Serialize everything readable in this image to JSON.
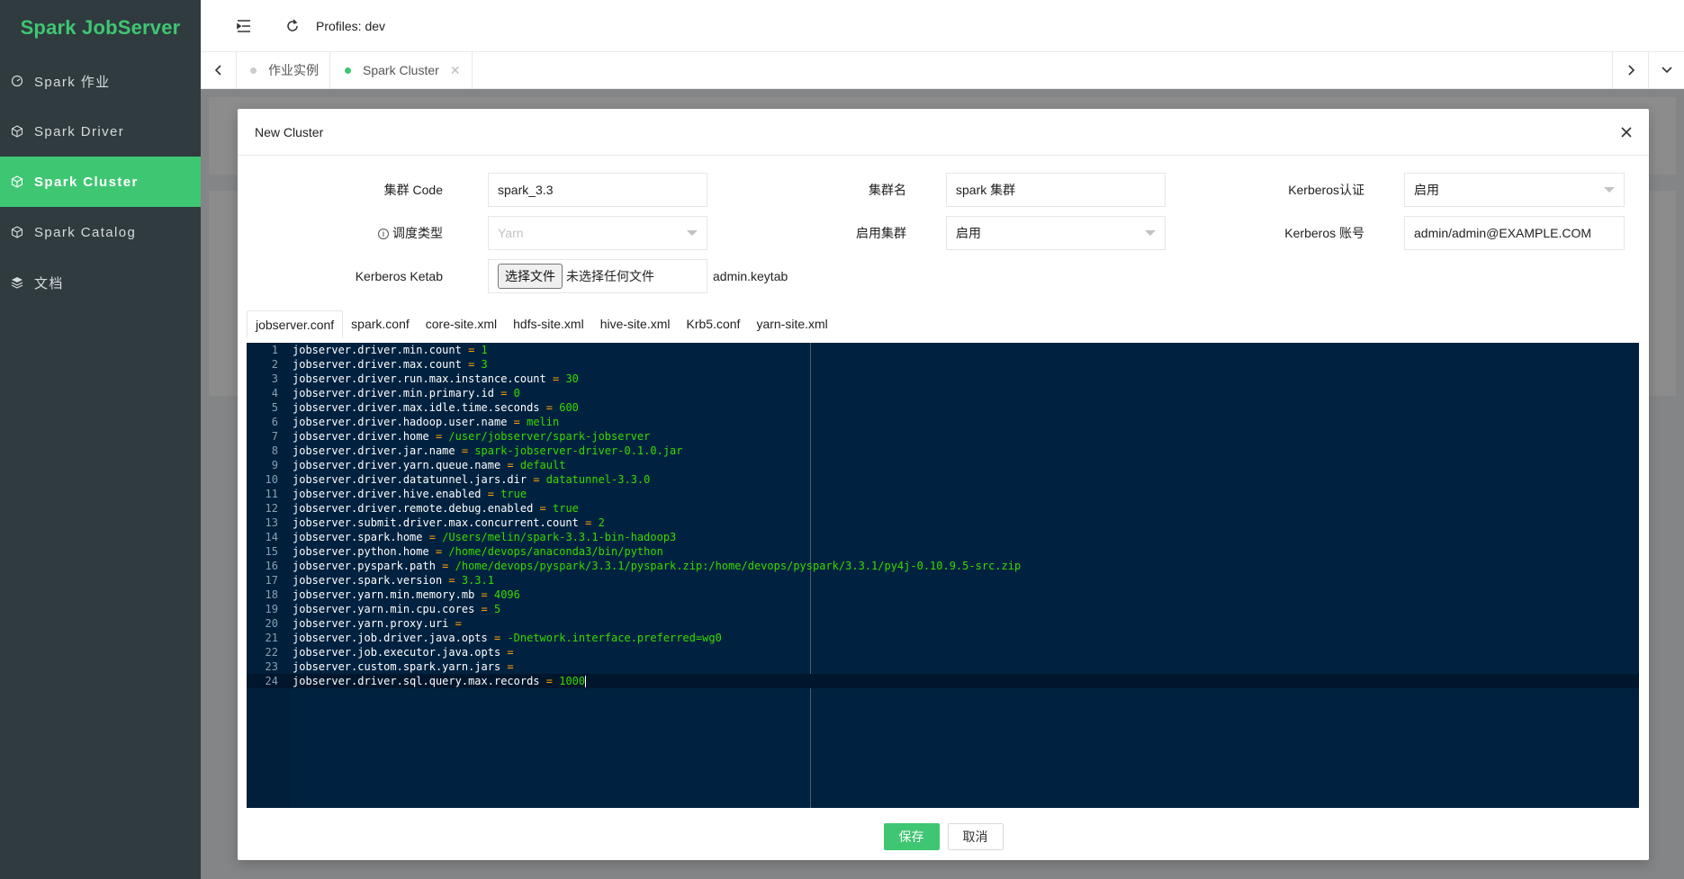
{
  "app": {
    "title": "Spark JobServer"
  },
  "sidebar": {
    "items": [
      {
        "label": "Spark 作业",
        "icon": "gauge-icon",
        "active": false
      },
      {
        "label": "Spark Driver",
        "icon": "cube-icon",
        "active": false
      },
      {
        "label": "Spark Cluster",
        "icon": "cube-icon",
        "active": true
      },
      {
        "label": "Spark Catalog",
        "icon": "cube-icon",
        "active": false
      },
      {
        "label": "文档",
        "icon": "layers-icon",
        "active": false
      }
    ]
  },
  "header": {
    "profiles": "Profiles: dev"
  },
  "page_tabs": [
    {
      "label": "作业实例",
      "dot_color": "#cccccc",
      "closable": false
    },
    {
      "label": "Spark Cluster",
      "dot_color": "#3fc673",
      "closable": true
    }
  ],
  "modal": {
    "title": "New Cluster",
    "fields": {
      "cluster_code": {
        "label": "集群 Code",
        "value": "spark_3.3"
      },
      "cluster_name": {
        "label": "集群名",
        "value": "spark 集群"
      },
      "kerberos_auth": {
        "label": "Kerberos认证",
        "value": "启用"
      },
      "schedule_type": {
        "label": "调度类型",
        "value": "Yarn"
      },
      "enable_cluster": {
        "label": "启用集群",
        "value": "启用"
      },
      "kerberos_account": {
        "label": "Kerberos 账号",
        "value": "admin/admin@EXAMPLE.COM"
      },
      "kerberos_ketab": {
        "label": "Kerberos Ketab",
        "button": "选择文件",
        "file_status": "未选择任何文件",
        "current_file": "admin.keytab"
      }
    },
    "config_tabs": [
      "jobserver.conf",
      "spark.conf",
      "core-site.xml",
      "hdfs-site.xml",
      "hive-site.xml",
      "Krb5.conf",
      "yarn-site.xml"
    ],
    "active_config_tab": "jobserver.conf",
    "editor_lines": [
      {
        "key": "jobserver.driver.min.count",
        "value": "1"
      },
      {
        "key": "jobserver.driver.max.count",
        "value": "3"
      },
      {
        "key": "jobserver.driver.run.max.instance.count",
        "value": "30"
      },
      {
        "key": "jobserver.driver.min.primary.id",
        "value": "0"
      },
      {
        "key": "jobserver.driver.max.idle.time.seconds",
        "value": "600"
      },
      {
        "key": "jobserver.driver.hadoop.user.name",
        "value": "melin"
      },
      {
        "key": "jobserver.driver.home",
        "value": "/user/jobserver/spark-jobserver"
      },
      {
        "key": "jobserver.driver.jar.name",
        "value": "spark-jobserver-driver-0.1.0.jar"
      },
      {
        "key": "jobserver.driver.yarn.queue.name",
        "value": "default"
      },
      {
        "key": "jobserver.driver.datatunnel.jars.dir",
        "value": "datatunnel-3.3.0"
      },
      {
        "key": "jobserver.driver.hive.enabled",
        "value": "true"
      },
      {
        "key": "jobserver.driver.remote.debug.enabled",
        "value": "true"
      },
      {
        "key": "jobserver.submit.driver.max.concurrent.count",
        "value": "2"
      },
      {
        "key": "jobserver.spark.home",
        "value": "/Users/melin/spark-3.3.1-bin-hadoop3"
      },
      {
        "key": "jobserver.python.home",
        "value": "/home/devops/anaconda3/bin/python"
      },
      {
        "key": "jobserver.pyspark.path",
        "value": "/home/devops/pyspark/3.3.1/pyspark.zip:/home/devops/pyspark/3.3.1/py4j-0.10.9.5-src.zip"
      },
      {
        "key": "jobserver.spark.version",
        "value": "3.3.1"
      },
      {
        "key": "jobserver.yarn.min.memory.mb",
        "value": "4096"
      },
      {
        "key": "jobserver.yarn.min.cpu.cores",
        "value": "5"
      },
      {
        "key": "jobserver.yarn.proxy.uri",
        "value": ""
      },
      {
        "key": "jobserver.job.driver.java.opts",
        "value": "-Dnetwork.interface.preferred=wg0"
      },
      {
        "key": "jobserver.job.executor.java.opts",
        "value": ""
      },
      {
        "key": "jobserver.custom.spark.yarn.jars",
        "value": ""
      },
      {
        "key": "jobserver.driver.sql.query.max.records",
        "value": "1000"
      }
    ],
    "active_line": 24,
    "buttons": {
      "save": "保存",
      "cancel": "取消"
    }
  },
  "colors": {
    "accent": "#3fc673",
    "sidebar_bg": "#2f3b3e",
    "editor_bg": "#002240"
  }
}
